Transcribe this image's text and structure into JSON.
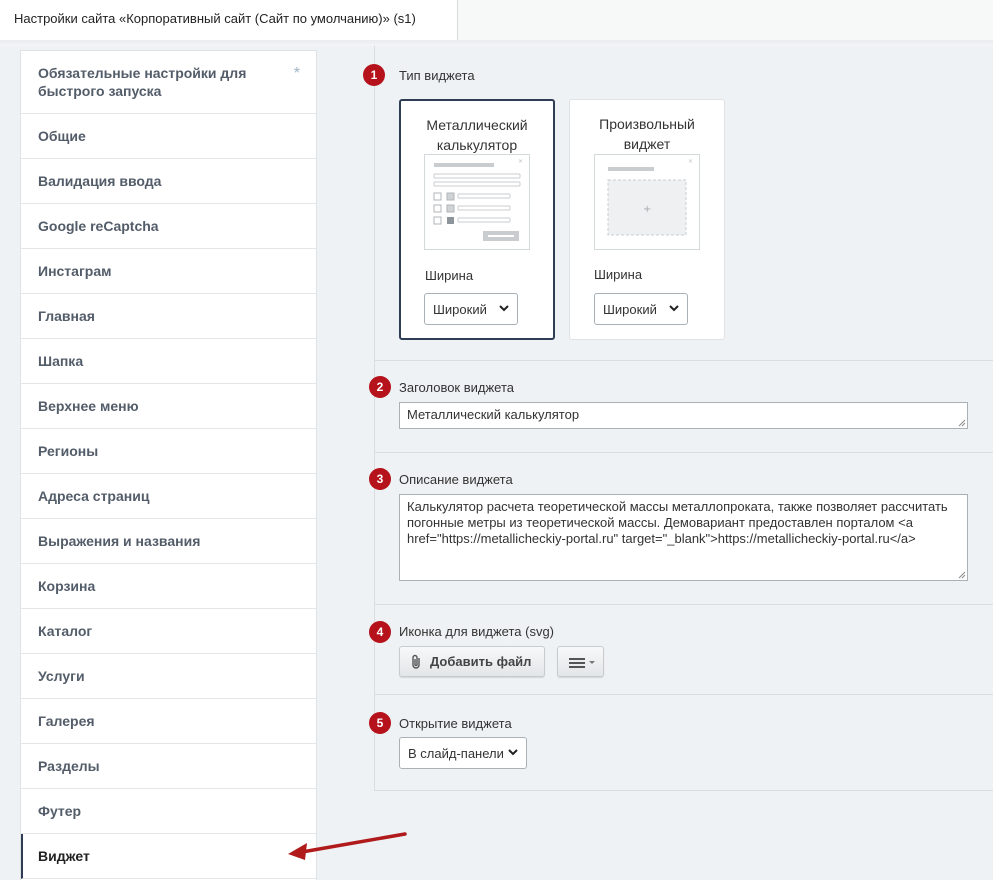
{
  "window": {
    "tab_title": "Настройки сайта «Корпоративный сайт (Сайт по умолчанию)» (s1)"
  },
  "sidebar": {
    "items": [
      {
        "label": "Обязательные настройки для быстрого запуска",
        "marker": "*"
      },
      {
        "label": "Общие"
      },
      {
        "label": "Валидация ввода"
      },
      {
        "label": "Google reCaptcha"
      },
      {
        "label": "Инстаграм"
      },
      {
        "label": "Главная"
      },
      {
        "label": "Шапка"
      },
      {
        "label": "Верхнее меню"
      },
      {
        "label": "Регионы"
      },
      {
        "label": "Адреса страниц"
      },
      {
        "label": "Выражения и названия"
      },
      {
        "label": "Корзина"
      },
      {
        "label": "Каталог"
      },
      {
        "label": "Услуги"
      },
      {
        "label": "Галерея"
      },
      {
        "label": "Разделы"
      },
      {
        "label": "Футер"
      },
      {
        "label": "Виджет"
      }
    ],
    "active": "Виджет"
  },
  "widget_type": {
    "number": "1",
    "label": "Тип виджета",
    "cards": [
      {
        "title": "Металлический калькулятор",
        "width_label": "Ширина",
        "width_value": "Широкий",
        "selected": true
      },
      {
        "title": "Произвольный виджет",
        "width_label": "Ширина",
        "width_value": "Широкий",
        "selected": false
      }
    ]
  },
  "widget_title": {
    "number": "2",
    "label": "Заголовок виджета",
    "value": "Металлический калькулятор"
  },
  "widget_description": {
    "number": "3",
    "label": "Описание виджета",
    "value": "Калькулятор расчета теоретической массы металлопроката, также позволяет рассчитать погонные метры из теоретической массы. Демовариант предоставлен порталом <a href=\"https://metallicheckiy-portal.ru\" target=\"_blank\">https://metallicheckiy-portal.ru</a>"
  },
  "widget_icon": {
    "number": "4",
    "label": "Иконка для виджета (svg)",
    "add_file_label": "Добавить файл"
  },
  "widget_open": {
    "number": "5",
    "label": "Открытие виджета",
    "value": "В слайд-панели"
  },
  "colors": {
    "accent": "#b5121b",
    "selected_border": "#2f3d54",
    "arrow": "#b01a1a"
  }
}
